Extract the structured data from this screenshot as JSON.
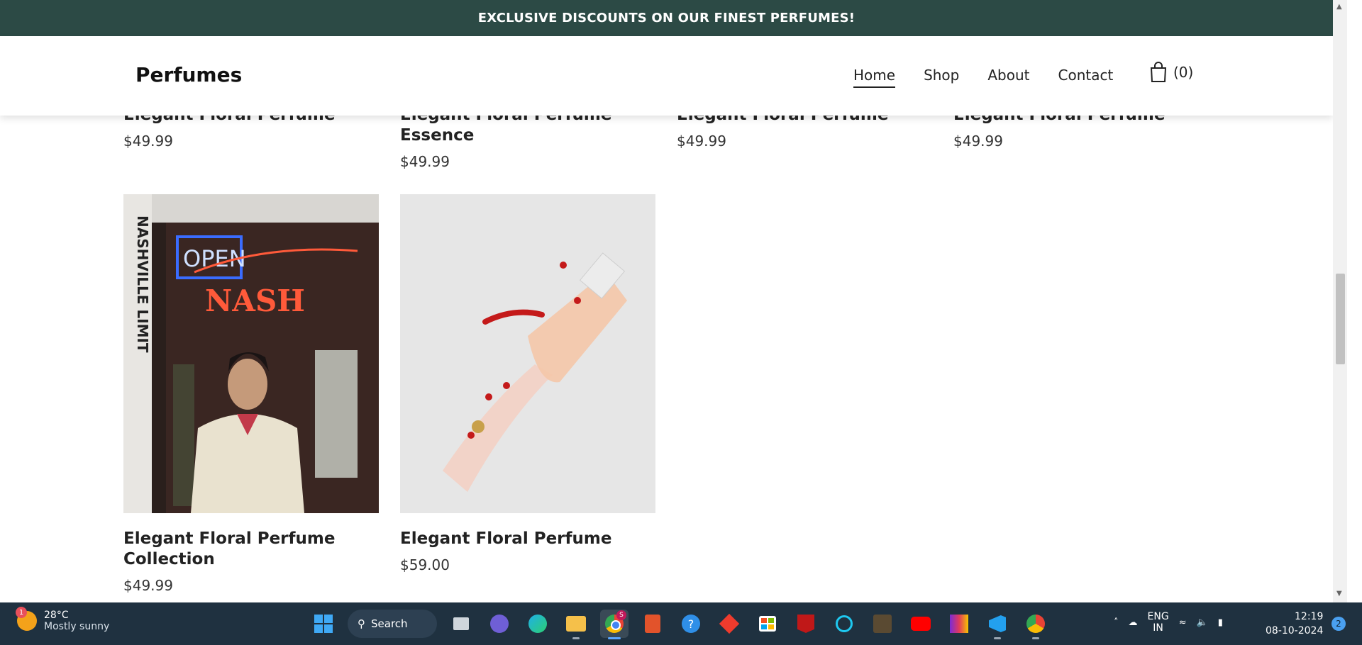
{
  "announcement": "EXCLUSIVE DISCOUNTS ON OUR FINEST PERFUMES!",
  "header": {
    "logo": "Perfumes",
    "nav": [
      "Home",
      "Shop",
      "About",
      "Contact"
    ],
    "cart_count": "(0)"
  },
  "top_row": [
    {
      "name": "Elegant Floral Perfume",
      "price": "$49.99"
    },
    {
      "name": "Elegant Floral Perfume Essence",
      "price": "$49.99"
    },
    {
      "name": "Elegant Floral Perfume",
      "price": "$49.99"
    },
    {
      "name": "Elegant Floral Perfume",
      "price": "$49.99"
    }
  ],
  "products": [
    {
      "name": "Elegant Floral Perfume Collection",
      "price": "$49.99",
      "image_sign_1": "OPEN",
      "image_sign_2": "NASH"
    },
    {
      "name": "Elegant Floral Perfume",
      "price": "$59.00"
    }
  ],
  "taskbar": {
    "weather_temp": "28°C",
    "weather_desc": "Mostly sunny",
    "weather_badge": "1",
    "search_label": "Search",
    "lang_1": "ENG",
    "lang_2": "IN",
    "time": "12:19",
    "date": "08-10-2024",
    "notifications": "2",
    "chrome_badge": "S"
  }
}
